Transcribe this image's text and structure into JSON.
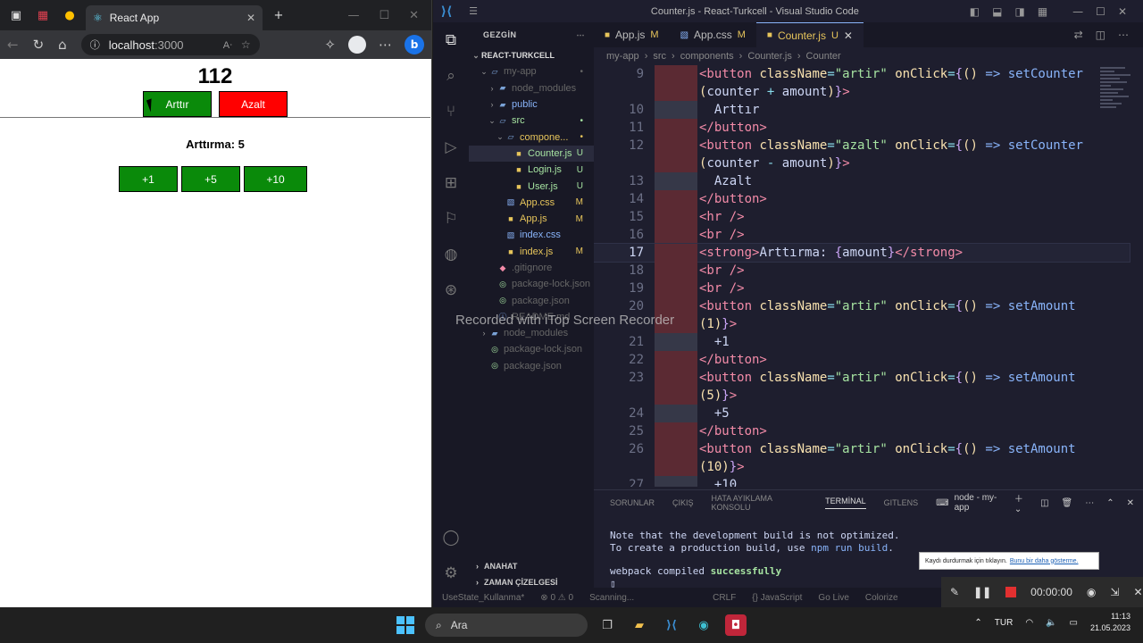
{
  "browser": {
    "tab_title": "React App",
    "address": "localhost",
    "port": ":3000",
    "page": {
      "counter": "112",
      "inc_label": "Arttır",
      "dec_label": "Azalt",
      "amount_label": "Arttırma: 5",
      "amount_buttons": [
        "+1",
        "+5",
        "+10"
      ]
    }
  },
  "vscode": {
    "window_title": "Counter.js - React-Turkcell - Visual Studio Code",
    "explorer": {
      "header": "GEZGİN",
      "workspace": "REACT-TURKCELL",
      "tree": [
        {
          "name": "my-app",
          "type": "folder-open",
          "indent": 1,
          "badge": "•",
          "color": "c-dim"
        },
        {
          "name": "node_modules",
          "type": "folder",
          "indent": 2,
          "badge": "",
          "color": "c-dim"
        },
        {
          "name": "public",
          "type": "folder",
          "indent": 2,
          "badge": "",
          "color": "c-blue"
        },
        {
          "name": "src",
          "type": "folder-open",
          "indent": 2,
          "badge": "•",
          "color": "c-green"
        },
        {
          "name": "compone...",
          "type": "folder-open",
          "indent": 3,
          "badge": "•",
          "color": "c-yellow"
        },
        {
          "name": "Counter.js",
          "type": "js",
          "indent": 4,
          "badge": "U",
          "color": "c-green",
          "selected": true
        },
        {
          "name": "Login.js",
          "type": "js",
          "indent": 4,
          "badge": "U",
          "color": "c-green"
        },
        {
          "name": "User.js",
          "type": "js",
          "indent": 4,
          "badge": "U",
          "color": "c-green"
        },
        {
          "name": "App.css",
          "type": "css",
          "indent": 3,
          "badge": "M",
          "color": "c-yellow"
        },
        {
          "name": "App.js",
          "type": "js",
          "indent": 3,
          "badge": "M",
          "color": "c-yellow"
        },
        {
          "name": "index.css",
          "type": "css",
          "indent": 3,
          "badge": "",
          "color": "c-blue"
        },
        {
          "name": "index.js",
          "type": "js",
          "indent": 3,
          "badge": "M",
          "color": "c-yellow"
        },
        {
          "name": ".gitignore",
          "type": "git",
          "indent": 2,
          "badge": "",
          "color": "c-dim"
        },
        {
          "name": "package-lock.json",
          "type": "json",
          "indent": 2,
          "badge": "",
          "color": "c-dim"
        },
        {
          "name": "package.json",
          "type": "json",
          "indent": 2,
          "badge": "",
          "color": "c-dim"
        },
        {
          "name": "README.md",
          "type": "md",
          "indent": 2,
          "badge": "",
          "color": "c-dim"
        },
        {
          "name": "node_modules",
          "type": "folder",
          "indent": 1,
          "badge": "",
          "color": "c-dim"
        },
        {
          "name": "package-lock.json",
          "type": "json",
          "indent": 1,
          "badge": "",
          "color": "c-dim"
        },
        {
          "name": "package.json",
          "type": "json",
          "indent": 1,
          "badge": "",
          "color": "c-dim"
        }
      ],
      "outline": "ANAHAT",
      "timeline": "ZAMAN ÇİZELGESİ"
    },
    "tabs": [
      {
        "name": "App.js",
        "badge": "M",
        "kind": "js",
        "active": false
      },
      {
        "name": "App.css",
        "badge": "M",
        "kind": "css",
        "active": false
      },
      {
        "name": "Counter.js",
        "badge": "U",
        "kind": "js",
        "active": true
      }
    ],
    "breadcrumb": [
      "my-app",
      "src",
      "components",
      "Counter.js",
      "Counter"
    ],
    "code": [
      {
        "ln": "9",
        "gut": "red",
        "html": "<span class='t-tag'>&lt;button</span> <span class='t-attr'>className</span><span class='t-op'>=</span><span class='t-str'>\"artir\"</span> <span class='t-attr'>onClick</span><span class='t-op'>=</span><span class='t-brace'>{</span><span class='t-par'>()</span> <span class='t-kw'>=&gt;</span> <span class='t-fn'>setCounter</span>"
      },
      {
        "ln": "",
        "gut": "red",
        "html": "<span class='t-par'>(</span><span class='t-txt'>counter</span> <span class='t-op'>+</span> <span class='t-txt'>amount</span><span class='t-par'>)</span><span class='t-brace'>}</span><span class='t-tag'>&gt;</span>"
      },
      {
        "ln": "10",
        "gut": "gray",
        "html": "<span class='t-txt'>  Arttır</span>"
      },
      {
        "ln": "11",
        "gut": "red",
        "html": "<span class='t-tag'>&lt;/button&gt;</span>"
      },
      {
        "ln": "12",
        "gut": "red",
        "html": "<span class='t-tag'>&lt;button</span> <span class='t-attr'>className</span><span class='t-op'>=</span><span class='t-str'>\"azalt\"</span> <span class='t-attr'>onClick</span><span class='t-op'>=</span><span class='t-brace'>{</span><span class='t-par'>()</span> <span class='t-kw'>=&gt;</span> <span class='t-fn'>setCounter</span>"
      },
      {
        "ln": "",
        "gut": "red",
        "html": "<span class='t-par'>(</span><span class='t-txt'>counter</span> <span class='t-op'>-</span> <span class='t-txt'>amount</span><span class='t-par'>)</span><span class='t-brace'>}</span><span class='t-tag'>&gt;</span>"
      },
      {
        "ln": "13",
        "gut": "gray",
        "html": "<span class='t-txt'>  Azalt</span>"
      },
      {
        "ln": "14",
        "gut": "red",
        "html": "<span class='t-tag'>&lt;/button&gt;</span>"
      },
      {
        "ln": "15",
        "gut": "red",
        "html": "<span class='t-tag'>&lt;hr /&gt;</span>"
      },
      {
        "ln": "16",
        "gut": "red",
        "html": "<span class='t-tag'>&lt;br /&gt;</span>"
      },
      {
        "ln": "17",
        "gut": "red",
        "cur": true,
        "html": "<span class='t-tag'>&lt;strong&gt;</span><span class='t-txt'>Arttırma: </span><span class='t-brace'>{</span><span class='t-txt'>amount</span><span class='t-brace'>}</span><span class='t-tag'>&lt;/strong&gt;</span>"
      },
      {
        "ln": "18",
        "gut": "red",
        "html": "<span class='t-tag'>&lt;br /&gt;</span>"
      },
      {
        "ln": "19",
        "gut": "red",
        "html": "<span class='t-tag'>&lt;br /&gt;</span>"
      },
      {
        "ln": "20",
        "gut": "red",
        "html": "<span class='t-tag'>&lt;button</span> <span class='t-attr'>className</span><span class='t-op'>=</span><span class='t-str'>\"artir\"</span> <span class='t-attr'>onClick</span><span class='t-op'>=</span><span class='t-brace'>{</span><span class='t-par'>()</span> <span class='t-kw'>=&gt;</span> <span class='t-fn'>setAmount</span>"
      },
      {
        "ln": "",
        "gut": "red",
        "html": "<span class='t-par'>(1)</span><span class='t-brace'>}</span><span class='t-tag'>&gt;</span>"
      },
      {
        "ln": "21",
        "gut": "gray",
        "html": "<span class='t-txt'>  +1</span>"
      },
      {
        "ln": "22",
        "gut": "red",
        "html": "<span class='t-tag'>&lt;/button&gt;</span>"
      },
      {
        "ln": "23",
        "gut": "red",
        "html": "<span class='t-tag'>&lt;button</span> <span class='t-attr'>className</span><span class='t-op'>=</span><span class='t-str'>\"artir\"</span> <span class='t-attr'>onClick</span><span class='t-op'>=</span><span class='t-brace'>{</span><span class='t-par'>()</span> <span class='t-kw'>=&gt;</span> <span class='t-fn'>setAmount</span>"
      },
      {
        "ln": "",
        "gut": "red",
        "html": "<span class='t-par'>(5)</span><span class='t-brace'>}</span><span class='t-tag'>&gt;</span>"
      },
      {
        "ln": "24",
        "gut": "gray",
        "html": "<span class='t-txt'>  +5</span>"
      },
      {
        "ln": "25",
        "gut": "red",
        "html": "<span class='t-tag'>&lt;/button&gt;</span>"
      },
      {
        "ln": "26",
        "gut": "red",
        "html": "<span class='t-tag'>&lt;button</span> <span class='t-attr'>className</span><span class='t-op'>=</span><span class='t-str'>\"artir\"</span> <span class='t-attr'>onClick</span><span class='t-op'>=</span><span class='t-brace'>{</span><span class='t-par'>()</span> <span class='t-kw'>=&gt;</span> <span class='t-fn'>setAmount</span>"
      },
      {
        "ln": "",
        "gut": "red",
        "html": "<span class='t-par'>(10)</span><span class='t-brace'>}</span><span class='t-tag'>&gt;</span>"
      },
      {
        "ln": "27",
        "gut": "gray",
        "html": "<span class='t-txt'>  +10</span>"
      }
    ],
    "panel": {
      "tabs": [
        "SORUNLAR",
        "ÇIKIŞ",
        "HATA AYIKLAMA KONSOLU",
        "TERMİNAL",
        "GITLENS"
      ],
      "active_tab": "TERMİNAL",
      "terminal_name": "node - my-app",
      "term_line1": "Note that the development build is not optimized.",
      "term_line2a": "To create a production build, use ",
      "term_line2b": "npm run build",
      "term_line2c": ".",
      "term_line3a": "webpack compiled ",
      "term_line3b": "successfully"
    },
    "status": [
      "UseState_Kullanma*",
      "⊗ 0 ⚠ 0",
      "Scanning...",
      "CRLF",
      "{} JavaScript",
      "Go Live",
      "Colorize"
    ]
  },
  "overlay": {
    "watermark": "Recorded with iTop Screen Recorder",
    "tooltip_text": "Kaydı durdurmak için tıklayın.",
    "tooltip_link": "Bunu bir daha gösterme.",
    "rec_time": "00:00:00"
  },
  "taskbar": {
    "search": "Ara",
    "lang": "TUR",
    "time": "11:13",
    "date": "21.05.2023"
  },
  "colors": {
    "accent_green": "#0a8a0a",
    "accent_red": "#ff0000",
    "vscode_bg": "#1e1e2e"
  }
}
